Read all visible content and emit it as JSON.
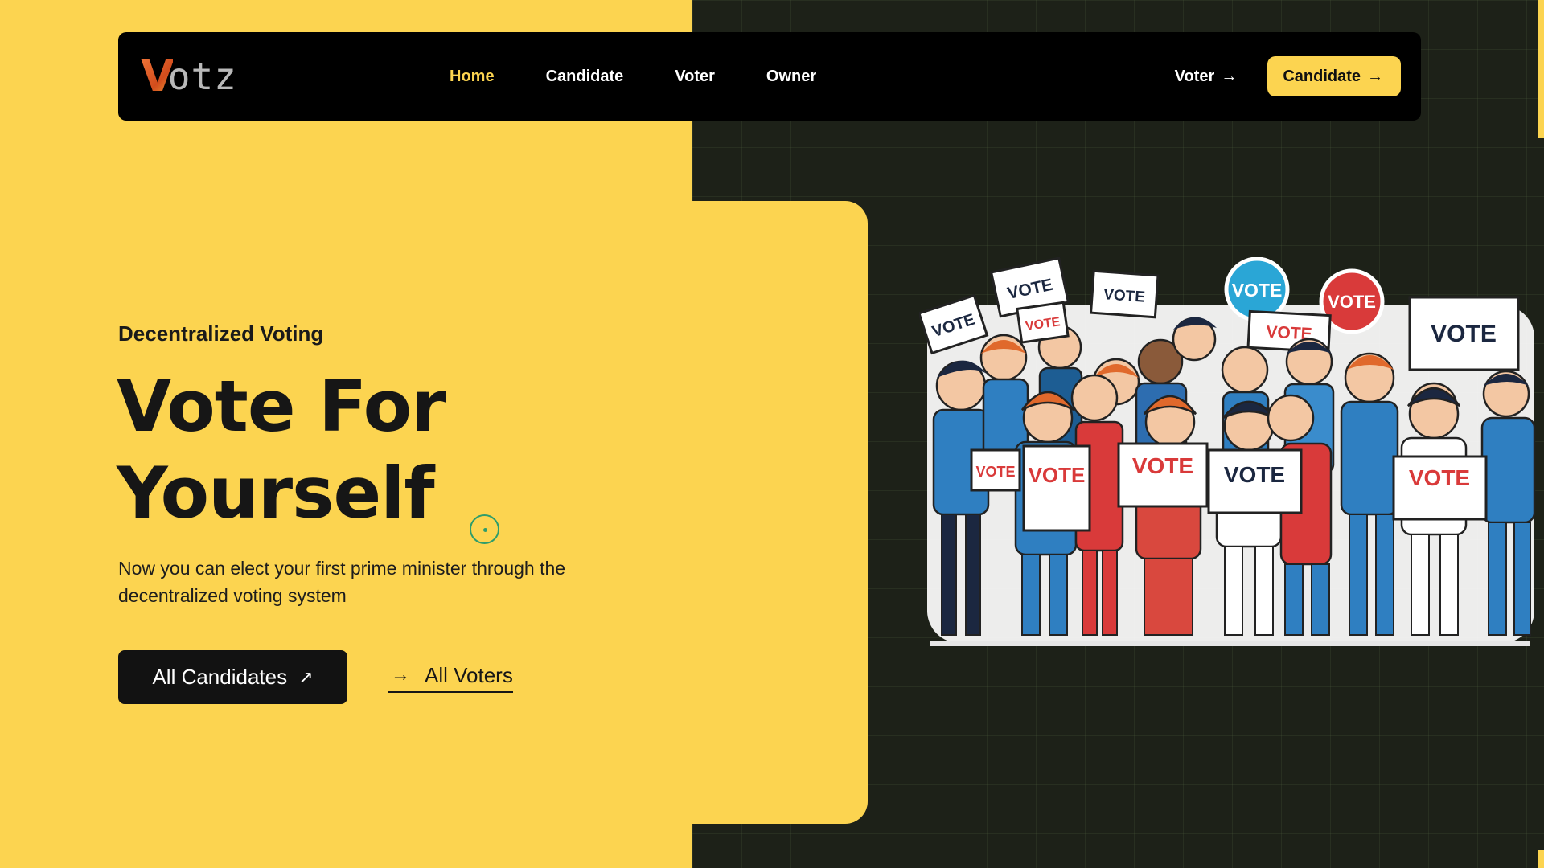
{
  "colors": {
    "accent": "#fcd450",
    "dark": "#121212",
    "background_dark": "#1d2118",
    "vote_red": "#d93a3a",
    "vote_blue": "#2aa6d6"
  },
  "brand": {
    "logo_letter": "V",
    "logo_rest": "otz"
  },
  "nav": {
    "links": [
      {
        "label": "Home",
        "active": true
      },
      {
        "label": "Candidate",
        "active": false
      },
      {
        "label": "Voter",
        "active": false
      },
      {
        "label": "Owner",
        "active": false
      }
    ],
    "voter_link": "Voter",
    "candidate_button": "Candidate",
    "arrow_icon": "→"
  },
  "hero": {
    "eyebrow": "Decentralized Voting",
    "headline_line1": "Vote For",
    "headline_line2": "Yourself",
    "subtext": "Now you can elect your first prime minister through the decentralized voting system",
    "primary_button": "All Candidates",
    "primary_button_icon": "↗",
    "secondary_link": "All Voters",
    "secondary_link_icon": "→"
  },
  "illustration": {
    "signs": [
      "VOTE",
      "VOTE",
      "VOTE",
      "VOTE",
      "VOTE",
      "VOTE",
      "VOTE",
      "VOTE",
      "VOTE",
      "VOTE",
      "VOTE",
      "VOTE",
      "VOTE"
    ]
  }
}
